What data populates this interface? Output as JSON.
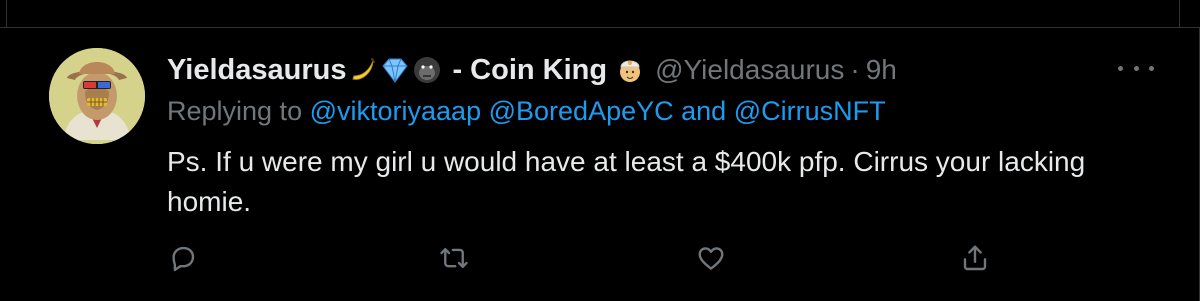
{
  "tweet": {
    "display_name": "Yieldasaurus",
    "name_suffix": "- Coin King",
    "handle": "@Yieldasaurus",
    "separator": "·",
    "time": "9h",
    "replying_prefix": "Replying to",
    "replying_user_1": "@viktoriyaaap",
    "replying_user_2": "@BoredApeYC",
    "replying_and": "and",
    "replying_user_3": "@CirrusNFT",
    "text": "Ps. If u were my girl u would have at least a $400k pfp. Cirrus your lacking homie.",
    "name_emojis": [
      "banana-icon",
      "gem-icon",
      "gorilla-icon"
    ],
    "suffix_emoji": "genie-icon"
  },
  "actions": [
    {
      "icon": "reply-icon"
    },
    {
      "icon": "retweet-icon"
    },
    {
      "icon": "like-icon"
    },
    {
      "icon": "share-icon"
    }
  ],
  "colors": {
    "background": "#000000",
    "text_primary": "#e7e9ea",
    "text_secondary": "#71767b",
    "link": "#1d9bf0",
    "border": "#2f3336"
  }
}
